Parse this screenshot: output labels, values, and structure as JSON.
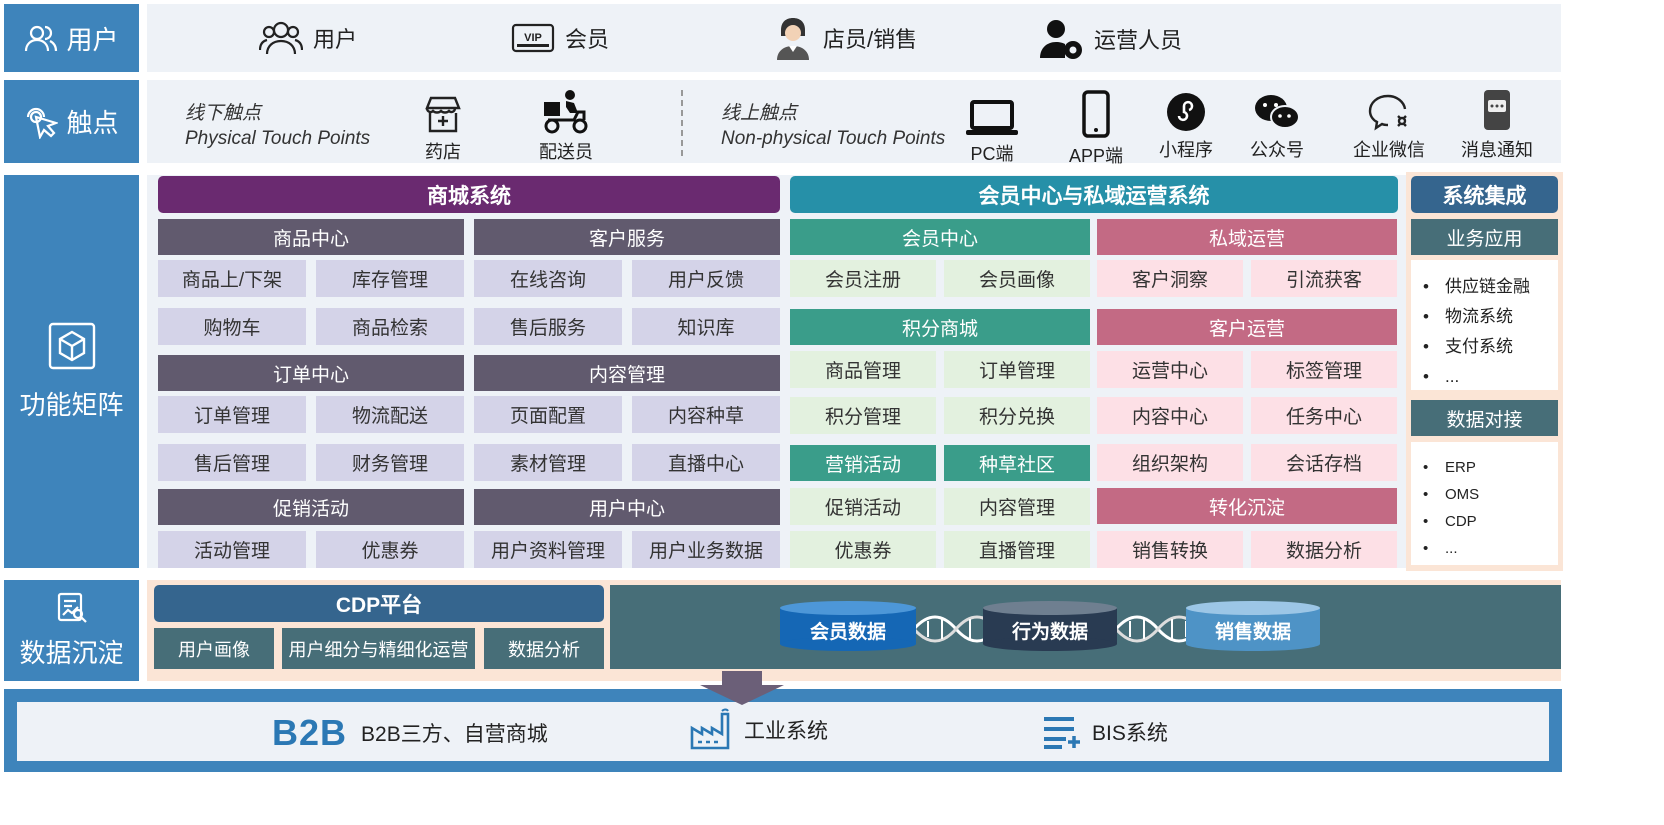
{
  "users": {
    "label": "用户",
    "items": [
      {
        "label": "用户",
        "icon": "users-icon"
      },
      {
        "label": "会员",
        "icon": "vip-card-icon"
      },
      {
        "label": "店员/销售",
        "icon": "clerk-icon"
      },
      {
        "label": "运营人员",
        "icon": "operator-icon"
      }
    ]
  },
  "touchpoints": {
    "label": "触点",
    "offline": {
      "title_cn": "线下触点",
      "title_en": "Physical Touch Points",
      "items": [
        "药店",
        "配送员"
      ]
    },
    "online": {
      "title_cn": "线上触点",
      "title_en": "Non-physical Touch Points",
      "items": [
        "PC端",
        "APP端",
        "小程序",
        "公众号",
        "企业微信",
        "消息通知"
      ]
    }
  },
  "matrix": {
    "label": "功能矩阵",
    "mall": {
      "title": "商城系统",
      "groups": [
        {
          "title": "商品中心",
          "items": [
            "商品上/下架",
            "库存管理",
            "购物车",
            "商品检索"
          ]
        },
        {
          "title": "客户服务",
          "items": [
            "在线咨询",
            "用户反馈",
            "售后服务",
            "知识库"
          ]
        },
        {
          "title": "订单中心",
          "items": [
            "订单管理",
            "物流配送",
            "售后管理",
            "财务管理"
          ]
        },
        {
          "title": "内容管理",
          "items": [
            "页面配置",
            "内容种草",
            "素材管理",
            "直播中心"
          ]
        },
        {
          "title": "促销活动",
          "items": [
            "活动管理",
            "优惠券"
          ]
        },
        {
          "title": "用户中心",
          "items": [
            "用户资料管理",
            "用户业务数据"
          ]
        }
      ]
    },
    "member": {
      "title": "会员中心与私域运营系统",
      "member_center": {
        "title": "会员中心",
        "items": [
          "会员注册",
          "会员画像"
        ]
      },
      "private_ops": {
        "title": "私域运营",
        "items": [
          "客户洞察",
          "引流获客"
        ]
      },
      "points_mall": {
        "title": "积分商城",
        "items": [
          "商品管理",
          "订单管理",
          "积分管理",
          "积分兑换"
        ]
      },
      "marketing": {
        "title": "营销活动",
        "items": [
          "促销活动",
          "优惠券"
        ]
      },
      "community": {
        "title": "种草社区",
        "items": [
          "内容管理",
          "直播管理"
        ]
      },
      "customer_ops": {
        "title": "客户运营",
        "items": [
          "运营中心",
          "标签管理",
          "内容中心",
          "任务中心",
          "组织架构",
          "会话存档"
        ]
      },
      "conversion": {
        "title": "转化沉淀",
        "items": [
          "销售转换",
          "数据分析"
        ]
      }
    },
    "integration": {
      "title": "系统集成",
      "business": {
        "title": "业务应用",
        "items": [
          "供应链金融",
          "物流系统",
          "支付系统",
          "..."
        ]
      },
      "data": {
        "title": "数据对接",
        "items": [
          "ERP",
          "OMS",
          "CDP",
          "..."
        ]
      }
    }
  },
  "data_layer": {
    "label": "数据沉淀",
    "cdp": {
      "title": "CDP平台",
      "items": [
        "用户画像",
        "用户细分与精细化运营",
        "数据分析"
      ]
    },
    "stores": [
      "会员数据",
      "行为数据",
      "销售数据"
    ]
  },
  "bottom": {
    "b2b_logo": "B2B",
    "items": [
      {
        "label": "B2B三方、自营商城"
      },
      {
        "label": "工业系统",
        "icon": "factory-icon"
      },
      {
        "label": "BIS系统",
        "icon": "list-plus-icon"
      }
    ]
  },
  "colors": {
    "label_blue": "#3e84bb",
    "mall_purple": "#6a2a70",
    "member_teal": "#2690a8",
    "integration_navy": "#35658e",
    "section_gray": "#615a6e",
    "cell_lavender": "#d4d3e8",
    "green": "#3a9d8a",
    "rose": "#c36a84",
    "slate": "#476e78"
  }
}
